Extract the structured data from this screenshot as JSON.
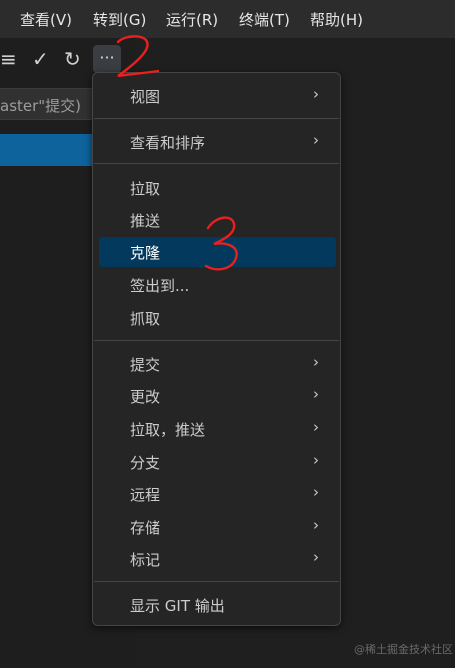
{
  "menubar": {
    "items": [
      {
        "label": "查看(V)"
      },
      {
        "label": "转到(G)"
      },
      {
        "label": "运行(R)"
      },
      {
        "label": "终端(T)"
      },
      {
        "label": "帮助(H)"
      }
    ]
  },
  "toolbar": {
    "list_icon": "≡",
    "check_icon": "✓",
    "refresh_icon": "↻",
    "more_icon": "···"
  },
  "commit_input": {
    "placeholder": "aster\"提交)"
  },
  "context_menu": {
    "items": [
      {
        "label": "视图",
        "chevron": "›"
      },
      {
        "label": "查看和排序",
        "chevron": "›"
      },
      {
        "label": "拉取"
      },
      {
        "label": "推送"
      },
      {
        "label": "克隆"
      },
      {
        "label": "签出到..."
      },
      {
        "label": "抓取"
      },
      {
        "label": "提交",
        "chevron": "›"
      },
      {
        "label": "更改",
        "chevron": "›"
      },
      {
        "label": "拉取，推送",
        "chevron": "›"
      },
      {
        "label": "分支",
        "chevron": "›"
      },
      {
        "label": "远程",
        "chevron": "›"
      },
      {
        "label": "存储",
        "chevron": "›"
      },
      {
        "label": "标记",
        "chevron": "›"
      },
      {
        "label": "显示 GIT 输出"
      }
    ],
    "active_item": "克隆"
  },
  "annotations": {
    "mark_2": "2",
    "mark_3": "3",
    "color": "#e8201e"
  },
  "watermark": "@稀土掘金技术社区"
}
